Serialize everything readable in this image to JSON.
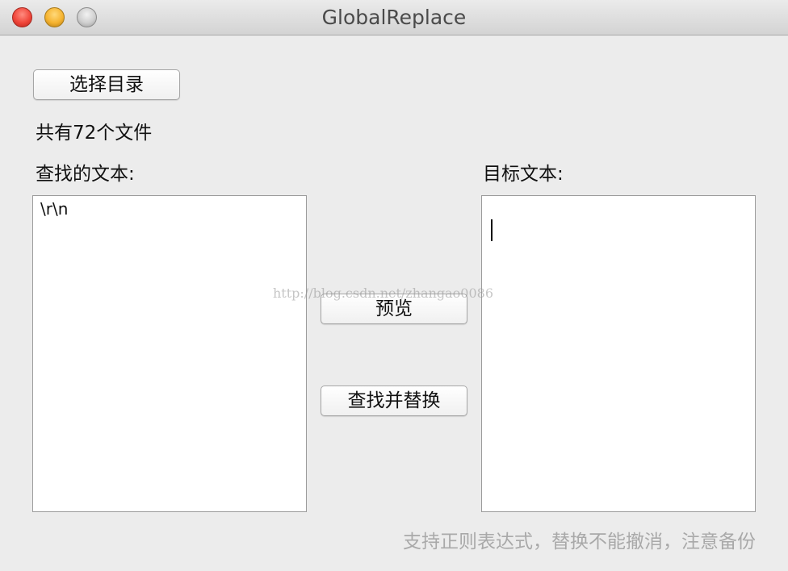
{
  "window": {
    "title": "GlobalReplace"
  },
  "toolbar": {
    "select_dir_label": "选择目录"
  },
  "status": {
    "file_count_text": "共有72个文件"
  },
  "search": {
    "label": "查找的文本:",
    "value": "\\r\\n"
  },
  "target": {
    "label": "目标文本:",
    "value": ""
  },
  "actions": {
    "preview_label": "预览",
    "find_replace_label": "查找并替换"
  },
  "hint": "支持正则表达式，替换不能撤消，注意备份",
  "watermark": "http://blog.csdn.net/zhangao0086",
  "colors": {
    "window_bg": "#ececec",
    "hint_text": "#a9a9a9",
    "close": "#f0463a",
    "minimize": "#f5b330",
    "zoom": "#cfcfcf"
  }
}
